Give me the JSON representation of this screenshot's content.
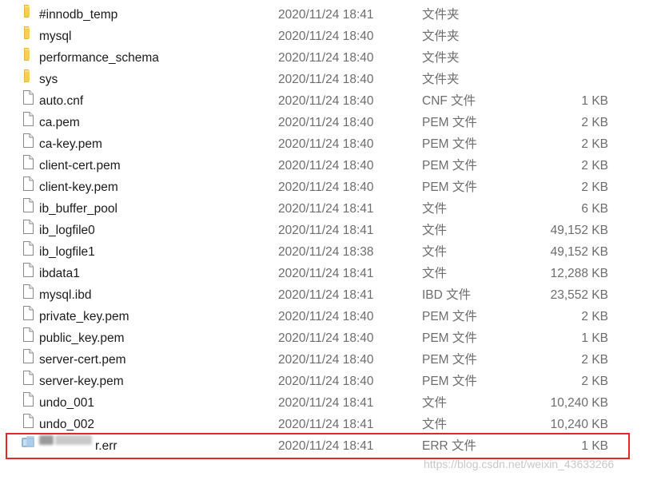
{
  "files": [
    {
      "name": "#innodb_temp",
      "modified": "2020/11/24 18:41",
      "type": "文件夹",
      "size": "",
      "icon": "folder-icon"
    },
    {
      "name": "mysql",
      "modified": "2020/11/24 18:40",
      "type": "文件夹",
      "size": "",
      "icon": "folder-icon"
    },
    {
      "name": "performance_schema",
      "modified": "2020/11/24 18:40",
      "type": "文件夹",
      "size": "",
      "icon": "folder-icon"
    },
    {
      "name": "sys",
      "modified": "2020/11/24 18:40",
      "type": "文件夹",
      "size": "",
      "icon": "folder-icon"
    },
    {
      "name": "auto.cnf",
      "modified": "2020/11/24 18:40",
      "type": "CNF 文件",
      "size": "1 KB",
      "icon": "file-icon"
    },
    {
      "name": "ca.pem",
      "modified": "2020/11/24 18:40",
      "type": "PEM 文件",
      "size": "2 KB",
      "icon": "file-icon"
    },
    {
      "name": "ca-key.pem",
      "modified": "2020/11/24 18:40",
      "type": "PEM 文件",
      "size": "2 KB",
      "icon": "file-icon"
    },
    {
      "name": "client-cert.pem",
      "modified": "2020/11/24 18:40",
      "type": "PEM 文件",
      "size": "2 KB",
      "icon": "file-icon"
    },
    {
      "name": "client-key.pem",
      "modified": "2020/11/24 18:40",
      "type": "PEM 文件",
      "size": "2 KB",
      "icon": "file-icon"
    },
    {
      "name": "ib_buffer_pool",
      "modified": "2020/11/24 18:41",
      "type": "文件",
      "size": "6 KB",
      "icon": "file-icon"
    },
    {
      "name": "ib_logfile0",
      "modified": "2020/11/24 18:41",
      "type": "文件",
      "size": "49,152 KB",
      "icon": "file-icon"
    },
    {
      "name": "ib_logfile1",
      "modified": "2020/11/24 18:38",
      "type": "文件",
      "size": "49,152 KB",
      "icon": "file-icon"
    },
    {
      "name": "ibdata1",
      "modified": "2020/11/24 18:41",
      "type": "文件",
      "size": "12,288 KB",
      "icon": "file-icon"
    },
    {
      "name": "mysql.ibd",
      "modified": "2020/11/24 18:41",
      "type": "IBD 文件",
      "size": "23,552 KB",
      "icon": "file-icon"
    },
    {
      "name": "private_key.pem",
      "modified": "2020/11/24 18:40",
      "type": "PEM 文件",
      "size": "2 KB",
      "icon": "file-icon"
    },
    {
      "name": "public_key.pem",
      "modified": "2020/11/24 18:40",
      "type": "PEM 文件",
      "size": "1 KB",
      "icon": "file-icon"
    },
    {
      "name": "server-cert.pem",
      "modified": "2020/11/24 18:40",
      "type": "PEM 文件",
      "size": "2 KB",
      "icon": "file-icon"
    },
    {
      "name": "server-key.pem",
      "modified": "2020/11/24 18:40",
      "type": "PEM 文件",
      "size": "2 KB",
      "icon": "file-icon"
    },
    {
      "name": "undo_001",
      "modified": "2020/11/24 18:41",
      "type": "文件",
      "size": "10,240 KB",
      "icon": "file-icon"
    },
    {
      "name": "undo_002",
      "modified": "2020/11/24 18:41",
      "type": "文件",
      "size": "10,240 KB",
      "icon": "file-icon"
    },
    {
      "name": "r.err",
      "modified": "2020/11/24 18:41",
      "type": "ERR 文件",
      "size": "1 KB",
      "icon": "err-file-icon",
      "name_partially_blurred": true
    }
  ],
  "colors": {
    "highlight_border": "#e02a2a",
    "folder": "#f4c54a",
    "text_primary": "#1b1b1b",
    "text_secondary": "#6d6d6d"
  },
  "watermark": "https://blog.csdn.net/weixin_43633266"
}
